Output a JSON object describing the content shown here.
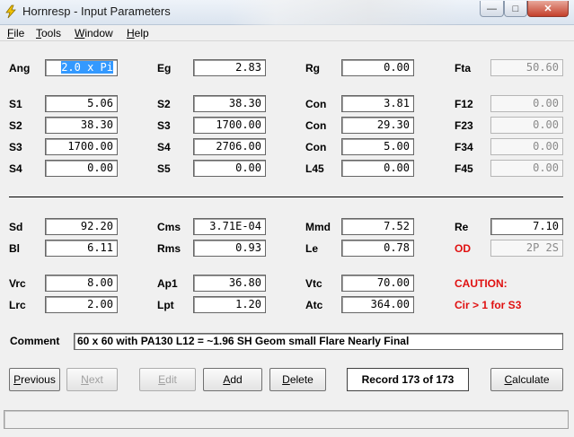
{
  "window": {
    "title": "Hornresp - Input Parameters"
  },
  "menu": [
    {
      "key": "F",
      "rest": "ile"
    },
    {
      "key": "T",
      "rest": "ools"
    },
    {
      "key": "W",
      "rest": "indow"
    },
    {
      "key": "H",
      "rest": "elp"
    }
  ],
  "params": {
    "ang": {
      "label": "Ang",
      "value": "2.0 x Pi"
    },
    "eg": {
      "label": "Eg",
      "value": "2.83"
    },
    "rg": {
      "label": "Rg",
      "value": "0.00"
    },
    "fta": {
      "label": "Fta",
      "value": "50.60"
    },
    "row1": {
      "s1": "S1",
      "s1v": "5.06",
      "s2": "S2",
      "s2v": "38.30",
      "con": "Con",
      "conv": "3.81",
      "f": "F12",
      "fv": "0.00"
    },
    "row2": {
      "s1": "S2",
      "s1v": "38.30",
      "s2": "S3",
      "s2v": "1700.00",
      "con": "Con",
      "conv": "29.30",
      "f": "F23",
      "fv": "0.00"
    },
    "row3": {
      "s1": "S3",
      "s1v": "1700.00",
      "s2": "S4",
      "s2v": "2706.00",
      "con": "Con",
      "conv": "5.00",
      "f": "F34",
      "fv": "0.00"
    },
    "row4": {
      "s1": "S4",
      "s1v": "0.00",
      "s2": "S5",
      "s2v": "0.00",
      "con": "L45",
      "conv": "0.00",
      "f": "F45",
      "fv": "0.00"
    }
  },
  "driver": {
    "sd": {
      "label": "Sd",
      "value": "92.20"
    },
    "cms": {
      "label": "Cms",
      "value": "3.71E-04"
    },
    "mmd": {
      "label": "Mmd",
      "value": "7.52"
    },
    "re": {
      "label": "Re",
      "value": "7.10"
    },
    "bl": {
      "label": "Bl",
      "value": "6.11"
    },
    "rms": {
      "label": "Rms",
      "value": "0.93"
    },
    "le": {
      "label": "Le",
      "value": "0.78"
    },
    "od": {
      "label": "OD",
      "value": "2P 2S"
    }
  },
  "chamber": {
    "vrc": {
      "label": "Vrc",
      "value": "8.00"
    },
    "ap1": {
      "label": "Ap1",
      "value": "36.80"
    },
    "vtc": {
      "label": "Vtc",
      "value": "70.00"
    },
    "lrc": {
      "label": "Lrc",
      "value": "2.00"
    },
    "lpt": {
      "label": "Lpt",
      "value": "1.20"
    },
    "atc": {
      "label": "Atc",
      "value": "364.00"
    }
  },
  "caution": {
    "title": "CAUTION:",
    "message": "Cir > 1 for S3"
  },
  "comment": {
    "label": "Comment",
    "value": "60 x 60 with PA130 L12 = ~1.96 SH Geom small Flare Nearly Final"
  },
  "buttons": {
    "previous": {
      "key": "P",
      "rest": "revious"
    },
    "next": {
      "key": "N",
      "rest": "ext"
    },
    "edit": {
      "key": "E",
      "rest": "dit"
    },
    "add": {
      "key": "A",
      "rest": "dd"
    },
    "delete": {
      "key": "D",
      "rest": "elete"
    },
    "calculate": {
      "key": "C",
      "rest": "alculate"
    }
  },
  "record": "Record 173 of 173",
  "colors": {
    "caution": "#e01010",
    "selection": "#3399ff",
    "close": "#c4402b"
  },
  "icons": {
    "app": "lightning-bolt-icon"
  }
}
